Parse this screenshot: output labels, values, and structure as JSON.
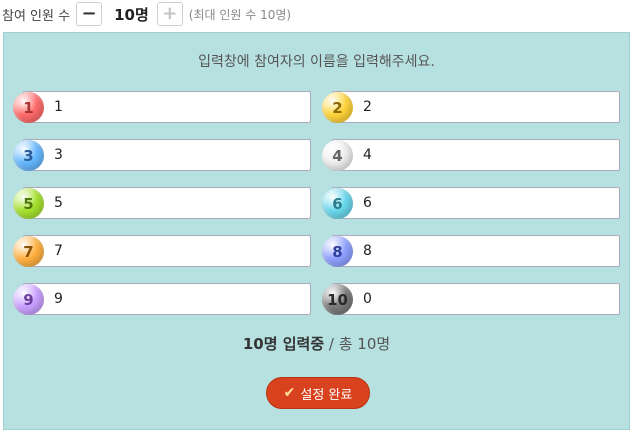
{
  "header": {
    "participants_label": "참여 인원 수",
    "minus_label": "−",
    "count": "10명",
    "plus_label": "+",
    "max_note": "(최대 인원 수 10명)"
  },
  "panel": {
    "instruction": "입력창에 참여자의 이름을 입력해주세요.",
    "entries": [
      {
        "num": "1",
        "value": "1",
        "color": "#ff6a6a",
        "text_color": "#a33"
      },
      {
        "num": "2",
        "value": "2",
        "color": "#ffd43a",
        "text_color": "#8a6a00"
      },
      {
        "num": "3",
        "value": "3",
        "color": "#66b8ff",
        "text_color": "#2a5d9a"
      },
      {
        "num": "4",
        "value": "4",
        "color": "#eeeeee",
        "text_color": "#666"
      },
      {
        "num": "5",
        "value": "5",
        "color": "#a6e22e",
        "text_color": "#4d7a0a"
      },
      {
        "num": "6",
        "value": "6",
        "color": "#6ad8ec",
        "text_color": "#2a7d8a"
      },
      {
        "num": "7",
        "value": "7",
        "color": "#ffb040",
        "text_color": "#8a5200"
      },
      {
        "num": "8",
        "value": "8",
        "color": "#8fa0ff",
        "text_color": "#2f3f9a"
      },
      {
        "num": "9",
        "value": "9",
        "color": "#c9a0ff",
        "text_color": "#6a3f9a"
      },
      {
        "num": "10",
        "value": "0",
        "color": "#7a7a7a",
        "text_color": "#2a2a2a"
      }
    ],
    "summary_bold": "10명 입력중",
    "summary_rest": " / 총 10명",
    "done_check": "✔",
    "done_label": "설정 완료"
  }
}
